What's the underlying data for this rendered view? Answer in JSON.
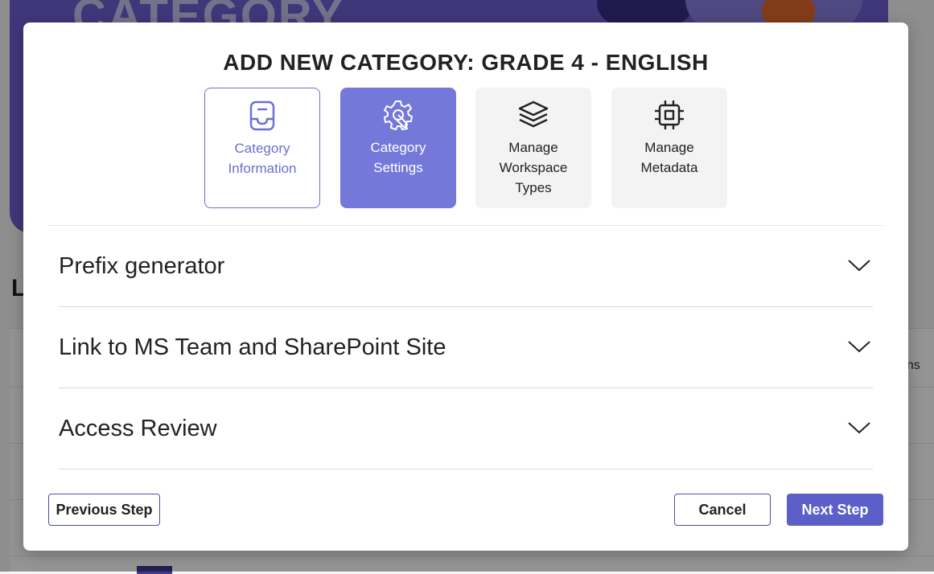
{
  "background": {
    "banner_title": "CATEGORY",
    "heading_fragment": "L",
    "column_fragment": "ons"
  },
  "modal": {
    "title": "ADD NEW CATEGORY: GRADE 4 - ENGLISH",
    "steps": [
      {
        "label": "Category Information",
        "icon": "inbox-icon",
        "state": "completed"
      },
      {
        "label": "Category Settings",
        "icon": "gear-wrench-icon",
        "state": "active"
      },
      {
        "label": "Manage Workspace Types",
        "icon": "layers-icon",
        "state": "inactive"
      },
      {
        "label": "Manage Metadata",
        "icon": "chip-icon",
        "state": "inactive"
      }
    ],
    "sections": [
      {
        "title": "Prefix generator",
        "expanded": false
      },
      {
        "title": "Link to MS Team and SharePoint Site",
        "expanded": false
      },
      {
        "title": "Access Review",
        "expanded": false
      }
    ],
    "buttons": {
      "previous": "Previous Step",
      "cancel": "Cancel",
      "next": "Next Step"
    }
  },
  "colors": {
    "accent": "#5b5fc7",
    "active_step": "#7479d9",
    "banner": "#6d5fd0"
  }
}
